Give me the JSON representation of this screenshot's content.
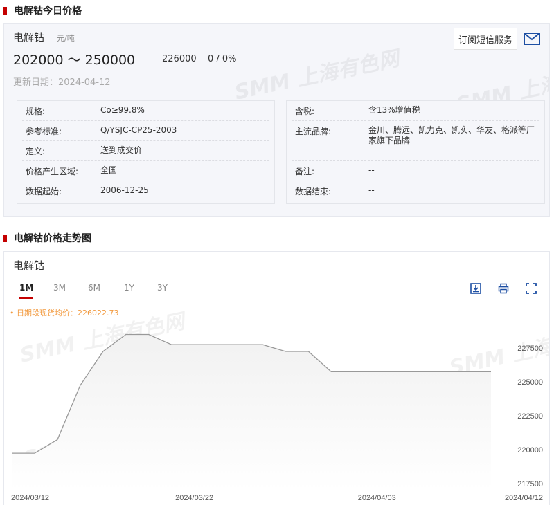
{
  "section1": {
    "title": "电解钴今日价格"
  },
  "price": {
    "name": "电解钴",
    "unit": "元/吨",
    "range": "202000 ～ 250000",
    "avg": "226000",
    "change": "0 / 0%",
    "update_date": "更新日期：2024-04-12",
    "subscribe_label": "订阅短信服务"
  },
  "watermark_text": "SMM 上海有色网",
  "specs_left": [
    {
      "k": "规格:",
      "v": "Co≥99.8%"
    },
    {
      "k": "参考标准:",
      "v": "Q/YSJC-CP25-2003"
    },
    {
      "k": "定义:",
      "v": "送到成交价"
    },
    {
      "k": "价格产生区域:",
      "v": "全国"
    },
    {
      "k": "数据起始:",
      "v": "2006-12-25"
    }
  ],
  "specs_right": [
    {
      "k": "含税:",
      "v": "含13%增值税"
    },
    {
      "k": "主流品牌:",
      "v": "金川、腾远、凯力克、凯实、华友、格派等厂家旗下品牌"
    },
    {
      "k": "备注:",
      "v": "--"
    },
    {
      "k": "数据结束:",
      "v": "--"
    }
  ],
  "section2": {
    "title": "电解钴价格走势图"
  },
  "chart_panel": {
    "name": "电解钴",
    "tabs": [
      "1M",
      "3M",
      "6M",
      "1Y",
      "3Y"
    ],
    "active_tab": "1M",
    "avg_label": "• 日期段现货均价：226022.73",
    "tools": [
      "download-icon",
      "print-icon",
      "fullscreen-icon"
    ]
  },
  "chart_data": {
    "type": "area",
    "x": [
      "2024/03/12",
      "2024/03/13",
      "2024/03/14",
      "2024/03/15",
      "2024/03/18",
      "2024/03/19",
      "2024/03/20",
      "2024/03/21",
      "2024/03/22",
      "2024/03/25",
      "2024/03/26",
      "2024/03/27",
      "2024/03/28",
      "2024/03/29",
      "2024/04/01",
      "2024/04/02",
      "2024/04/03",
      "2024/04/08",
      "2024/04/09",
      "2024/04/10",
      "2024/04/11",
      "2024/04/12"
    ],
    "values": [
      219750,
      219750,
      220750,
      224750,
      227250,
      228500,
      228500,
      227750,
      227750,
      227750,
      227750,
      227750,
      227250,
      227250,
      225750,
      225750,
      225750,
      225750,
      225750,
      225750,
      225750,
      225750
    ],
    "xticks": [
      "2024/03/12",
      "2024/03/22",
      "2024/04/03",
      "2024/04/12"
    ],
    "yticks": [
      217500,
      220000,
      222500,
      225000,
      227500
    ],
    "ylim": [
      217000,
      229750
    ],
    "color": "#999999",
    "fill_top": "#f1f1f1",
    "fill_bottom": "#ffffff",
    "title": "",
    "xlabel": "",
    "ylabel": ""
  }
}
